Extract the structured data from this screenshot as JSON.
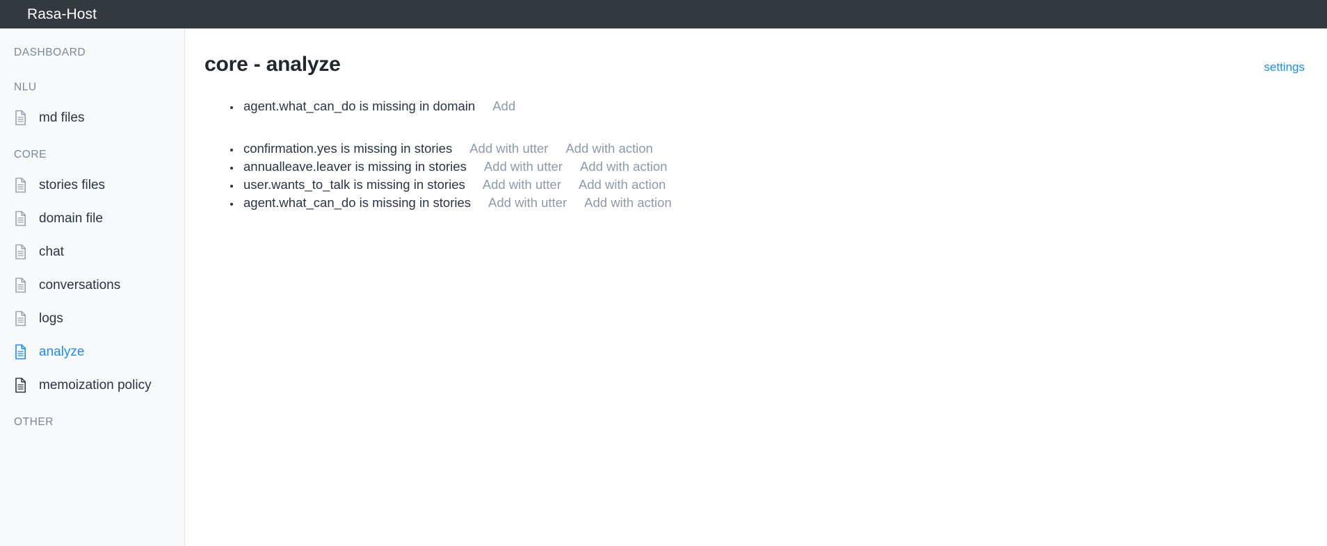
{
  "appbar": {
    "title": "Rasa-Host"
  },
  "sidebar": {
    "sections": [
      {
        "label": "DASHBOARD",
        "items": []
      },
      {
        "label": "NLU",
        "items": [
          {
            "label": "md files",
            "icon": "file-icon",
            "active": false
          }
        ]
      },
      {
        "label": "CORE",
        "items": [
          {
            "label": "stories files",
            "icon": "file-icon",
            "active": false
          },
          {
            "label": "domain file",
            "icon": "file-icon",
            "active": false
          },
          {
            "label": "chat",
            "icon": "file-icon",
            "active": false
          },
          {
            "label": "conversations",
            "icon": "file-icon",
            "active": false
          },
          {
            "label": "logs",
            "icon": "file-icon",
            "active": false
          },
          {
            "label": "analyze",
            "icon": "file-icon",
            "active": true
          },
          {
            "label": "memoization policy",
            "icon": "file-icon",
            "active": false
          }
        ]
      },
      {
        "label": "OTHER",
        "items": []
      }
    ]
  },
  "main": {
    "title": "core - analyze",
    "settings_label": "settings",
    "domain_issues": [
      {
        "text": "agent.what_can_do is missing in domain",
        "actions": [
          "Add"
        ]
      }
    ],
    "story_issues": [
      {
        "text": "confirmation.yes is missing in stories",
        "actions": [
          "Add with utter",
          "Add with action"
        ]
      },
      {
        "text": "annualleave.leaver is missing in stories",
        "actions": [
          "Add with utter",
          "Add with action"
        ]
      },
      {
        "text": "user.wants_to_talk is missing in stories",
        "actions": [
          "Add with utter",
          "Add with action"
        ]
      },
      {
        "text": "agent.what_can_do is missing in stories",
        "actions": [
          "Add with utter",
          "Add with action"
        ]
      }
    ]
  },
  "colors": {
    "appbar_bg": "#343a40",
    "sidebar_bg": "#f8f9fa",
    "accent": "#1a8cff",
    "action_link": "#8e9aa8",
    "text": "#2b3441",
    "section_label": "#7b8794"
  }
}
